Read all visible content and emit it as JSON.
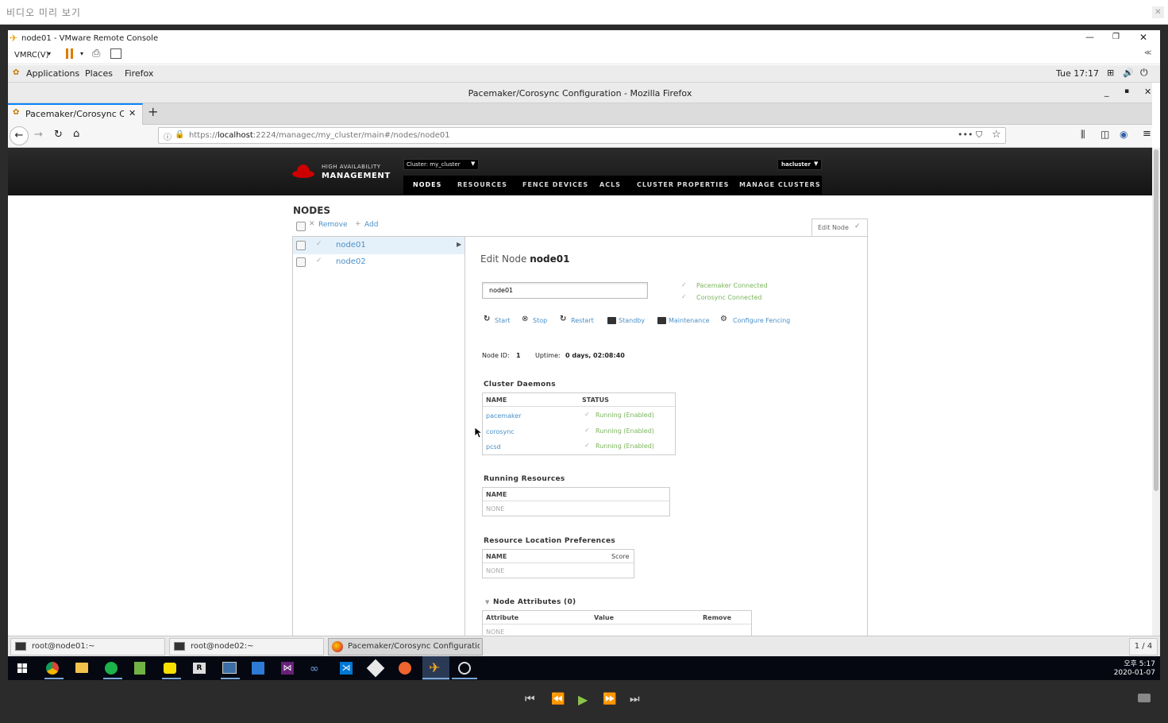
{
  "preview": {
    "title": "비디오 미리 보기",
    "close": "✕"
  },
  "vmrc": {
    "title": "node01 - VMware Remote Console",
    "menu": "VMRC(V)",
    "collapse": "≪"
  },
  "gnome": {
    "applications": "Applications",
    "places": "Places",
    "firefox": "Firefox",
    "clock": "Tue 17:17"
  },
  "firefox": {
    "window_title": "Pacemaker/Corosync Configuration - Mozilla Firefox",
    "tab_label": "Pacemaker/Corosync Con",
    "url_prefix": "https://",
    "url_host": "localhost",
    "url_path": ":2224/managec/my_cluster/main#/nodes/node01"
  },
  "pcs": {
    "brand_small": "HIGH AVAILABILITY",
    "brand_big": "MANAGEMENT",
    "cluster_dropdown": "Cluster: my_cluster",
    "user_dropdown": "hacluster",
    "nav": [
      "NODES",
      "RESOURCES",
      "FENCE DEVICES",
      "ACLS",
      "CLUSTER PROPERTIES",
      "MANAGE CLUSTERS"
    ]
  },
  "nodes_page": {
    "heading": "NODES",
    "remove": "Remove",
    "add": "Add",
    "edit_node_tab": "Edit Node",
    "nodes": [
      "node01",
      "node02"
    ],
    "edit_title_prefix": "Edit Node",
    "edit_title_node": "node01",
    "name_input": "node01",
    "status": [
      "Pacemaker Connected",
      "Corosync Connected"
    ],
    "actions": [
      "Start",
      "Stop",
      "Restart",
      "Standby",
      "Maintenance",
      "Configure Fencing"
    ],
    "node_id_label": "Node ID:",
    "node_id": "1",
    "uptime_label": "Uptime:",
    "uptime": "0 days, 02:08:40",
    "daemons_heading": "Cluster Daemons",
    "daemons_cols": [
      "NAME",
      "STATUS"
    ],
    "daemons": [
      {
        "name": "pacemaker",
        "status": "Running (Enabled)"
      },
      {
        "name": "corosync",
        "status": "Running (Enabled)"
      },
      {
        "name": "pcsd",
        "status": "Running (Enabled)"
      }
    ],
    "running_heading": "Running Resources",
    "running_col": "NAME",
    "running_none": "NONE",
    "location_heading": "Resource Location Preferences",
    "location_cols": [
      "NAME",
      "Score"
    ],
    "location_none": "NONE",
    "attr_heading": "Node Attributes (0)",
    "attr_cols": [
      "Attribute",
      "Value",
      "Remove"
    ],
    "attr_none": "NONE"
  },
  "vm_taskbar": {
    "tasks": [
      "root@node01:~",
      "root@node02:~",
      "Pacemaker/Corosync Configuration ..."
    ],
    "workspace": "1 / 4"
  },
  "windows": {
    "time": "오후 5:17",
    "date": "2020-01-07"
  },
  "colors": {
    "accent": "#0a84ff",
    "link": "#4a90c8",
    "ok": "#7ab55c",
    "redhat": "#cc0000"
  }
}
